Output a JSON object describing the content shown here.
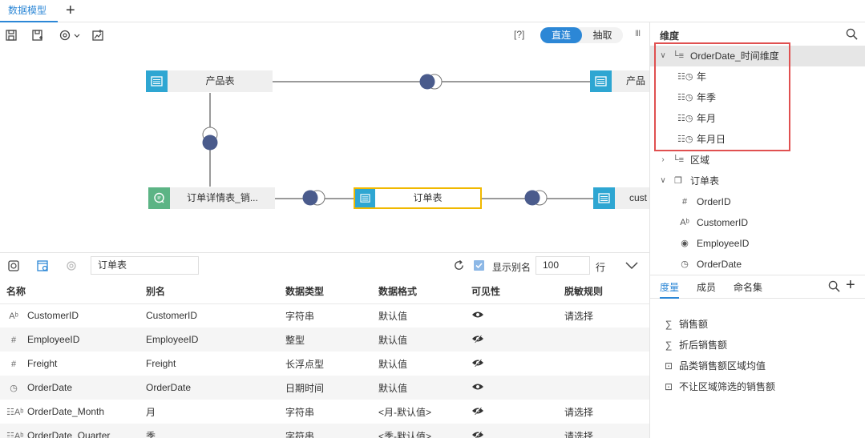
{
  "tabs": {
    "active": "数据模型",
    "add": "+"
  },
  "toolbar": {
    "help": "[?]",
    "mode_direct": "直连",
    "mode_extract": "抽取",
    "more": "III",
    "icons": [
      "save-icon",
      "save-as-icon",
      "settings-dropdown-icon",
      "image-export-icon"
    ]
  },
  "canvas": {
    "nodes": {
      "product": "产品表",
      "product2": "产品",
      "detail": "订单详情表_销...",
      "order": "订单表",
      "customer": "cust"
    }
  },
  "bottom": {
    "table_name": "订单表",
    "show_alias": "显示别名",
    "row_count": "100",
    "row_unit": "行",
    "columns": [
      "名称",
      "别名",
      "数据类型",
      "数据格式",
      "可见性",
      "脱敏规则"
    ],
    "rows": [
      {
        "icon": "Ab",
        "name": "CustomerID",
        "alias": "CustomerID",
        "type": "字符串",
        "format": "默认值",
        "visible": "eye",
        "mask": "请选择"
      },
      {
        "icon": "#",
        "name": "EmployeeID",
        "alias": "EmployeeID",
        "type": "整型",
        "format": "默认值",
        "visible": "eye-off",
        "mask": ""
      },
      {
        "icon": "#",
        "name": "Freight",
        "alias": "Freight",
        "type": "长浮点型",
        "format": "默认值",
        "visible": "eye-off",
        "mask": ""
      },
      {
        "icon": "date",
        "name": "OrderDate",
        "alias": "OrderDate",
        "type": "日期时间",
        "format": "默认值",
        "visible": "eye",
        "mask": ""
      },
      {
        "icon": "dAb",
        "name": "OrderDate_Month",
        "alias": "月",
        "type": "字符串",
        "format": "<月-默认值>",
        "visible": "eye-off",
        "mask": "请选择"
      },
      {
        "icon": "dAb",
        "name": "OrderDate_Quarter",
        "alias": "季",
        "type": "字符串",
        "format": "<季-默认值>",
        "visible": "eye-off",
        "mask": "请选择"
      }
    ]
  },
  "dimensions": {
    "title": "维度",
    "tree": [
      {
        "level": 0,
        "arrow": "down",
        "icon": "hierarchy",
        "label": "OrderDate_时间维度",
        "highlight": true
      },
      {
        "level": 1,
        "icon": "date-level",
        "label": "年"
      },
      {
        "level": 1,
        "icon": "date-level",
        "label": "年季"
      },
      {
        "level": 1,
        "icon": "date-level",
        "label": "年月"
      },
      {
        "level": 1,
        "icon": "date-level",
        "label": "年月日"
      },
      {
        "level": 0,
        "arrow": "right",
        "icon": "hierarchy",
        "label": "区域"
      },
      {
        "level": 0,
        "arrow": "down",
        "icon": "folder",
        "label": "订单表"
      },
      {
        "level": 1,
        "icon": "number",
        "label": "OrderID"
      },
      {
        "level": 1,
        "icon": "string",
        "label": "CustomerID"
      },
      {
        "level": 1,
        "icon": "hidden",
        "label": "EmployeeID"
      },
      {
        "level": 1,
        "icon": "date",
        "label": "OrderDate"
      }
    ]
  },
  "measures": {
    "tabs": [
      "度量",
      "成员",
      "命名集"
    ],
    "add": "+",
    "items": [
      {
        "icon": "sum",
        "label": "销售额"
      },
      {
        "icon": "sum",
        "label": "折后销售额"
      },
      {
        "icon": "calc",
        "label": "品类销售额区域均值"
      },
      {
        "icon": "calc",
        "label": "不让区域筛选的销售额"
      }
    ]
  }
}
